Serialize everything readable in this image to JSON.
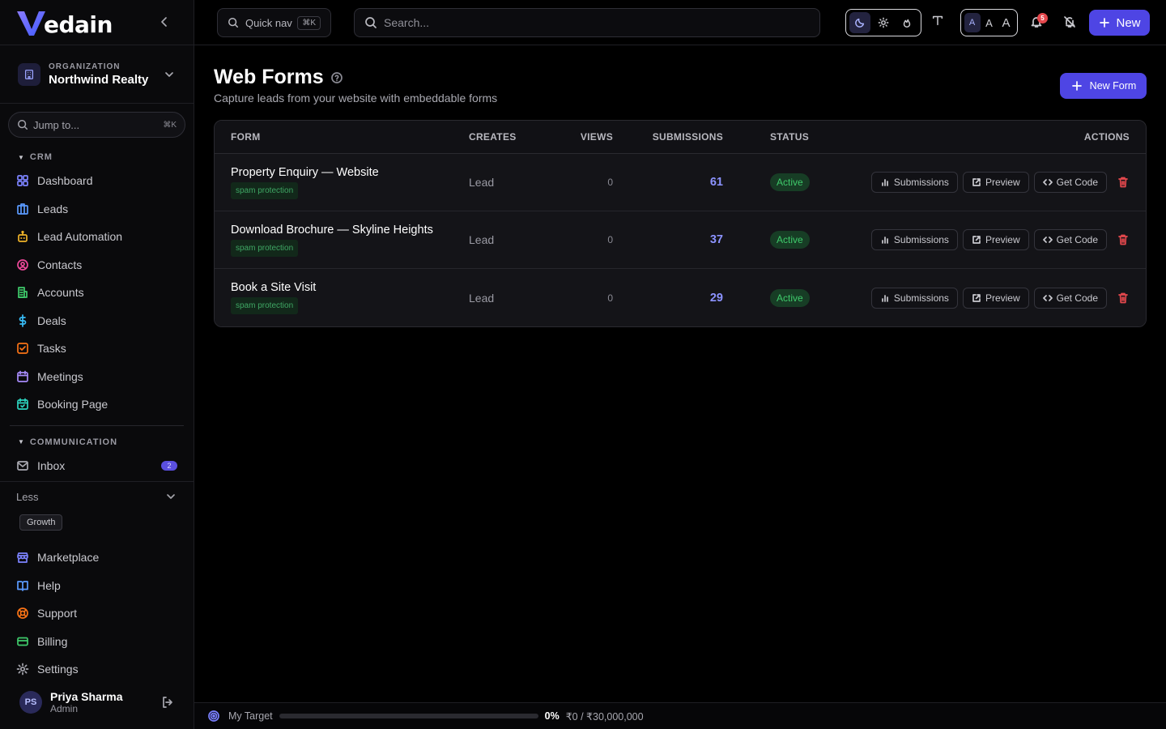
{
  "app": {
    "logo_text": "edain"
  },
  "org": {
    "label": "ORGANIZATION",
    "name": "Northwind Realty"
  },
  "jump": {
    "placeholder": "Jump to...",
    "shortcut": "⌘K"
  },
  "sidebar": {
    "crm_label": "CRM",
    "crm_items": [
      {
        "label": "Dashboard",
        "icon": "dashboard-icon",
        "color": "#7c83ff"
      },
      {
        "label": "Leads",
        "icon": "leads-icon",
        "color": "#5b9bff"
      },
      {
        "label": "Lead Automation",
        "icon": "automation-icon",
        "color": "#f0b429"
      },
      {
        "label": "Contacts",
        "icon": "contacts-icon",
        "color": "#ec4899"
      },
      {
        "label": "Accounts",
        "icon": "accounts-icon",
        "color": "#3fca6b"
      },
      {
        "label": "Deals",
        "icon": "deals-icon",
        "color": "#38bdf8"
      },
      {
        "label": "Tasks",
        "icon": "tasks-icon",
        "color": "#f97316"
      },
      {
        "label": "Meetings",
        "icon": "meetings-icon",
        "color": "#a78bfa"
      },
      {
        "label": "Booking Page",
        "icon": "booking-icon",
        "color": "#2dd4bf"
      }
    ],
    "comm_label": "COMMUNICATION",
    "comm_items": [
      {
        "label": "Inbox",
        "icon": "inbox-icon",
        "badge": "2",
        "color": "#a8a8b0"
      }
    ],
    "less_label": "Less",
    "plan": "Growth",
    "lower_items": [
      {
        "label": "Marketplace",
        "icon": "marketplace-icon",
        "color": "#7c83ff"
      },
      {
        "label": "Help",
        "icon": "help-book-icon",
        "color": "#5b9bff"
      },
      {
        "label": "Support",
        "icon": "support-icon",
        "color": "#f97316"
      },
      {
        "label": "Billing",
        "icon": "billing-icon",
        "color": "#3fca6b"
      },
      {
        "label": "Settings",
        "icon": "settings-icon",
        "color": "#a8a8b0"
      }
    ]
  },
  "user": {
    "initials": "PS",
    "name": "Priya Sharma",
    "role": "Admin"
  },
  "topbar": {
    "quicknav_label": "Quick nav",
    "quicknav_shortcut": "⌘K",
    "search_placeholder": "Search...",
    "font_sizes": [
      "A",
      "A",
      "A"
    ],
    "notification_count": "5",
    "new_label": "New"
  },
  "page": {
    "title": "Web Forms",
    "subtitle": "Capture leads from your website with embeddable forms",
    "new_form_label": "New Form"
  },
  "table": {
    "headers": {
      "form": "FORM",
      "creates": "CREATES",
      "views": "VIEWS",
      "submissions": "SUBMISSIONS",
      "status": "STATUS",
      "actions": "ACTIONS"
    },
    "rows": [
      {
        "name": "Property Enquiry — Website",
        "tag": "spam protection",
        "creates": "Lead",
        "views": "0",
        "submissions": "61",
        "status": "Active"
      },
      {
        "name": "Download Brochure — Skyline Heights",
        "tag": "spam protection",
        "creates": "Lead",
        "views": "0",
        "submissions": "37",
        "status": "Active"
      },
      {
        "name": "Book a Site Visit",
        "tag": "spam protection",
        "creates": "Lead",
        "views": "0",
        "submissions": "29",
        "status": "Active"
      }
    ],
    "action_labels": {
      "submissions": "Submissions",
      "preview": "Preview",
      "get_code": "Get Code"
    }
  },
  "target": {
    "label": "My Target",
    "percent": "0%",
    "progress_fraction": 0,
    "amount": "₹0 / ₹30,000,000"
  },
  "colors": {
    "accent": "#4e45e4",
    "active_green": "#3fca6b",
    "danger": "#e5484d"
  }
}
